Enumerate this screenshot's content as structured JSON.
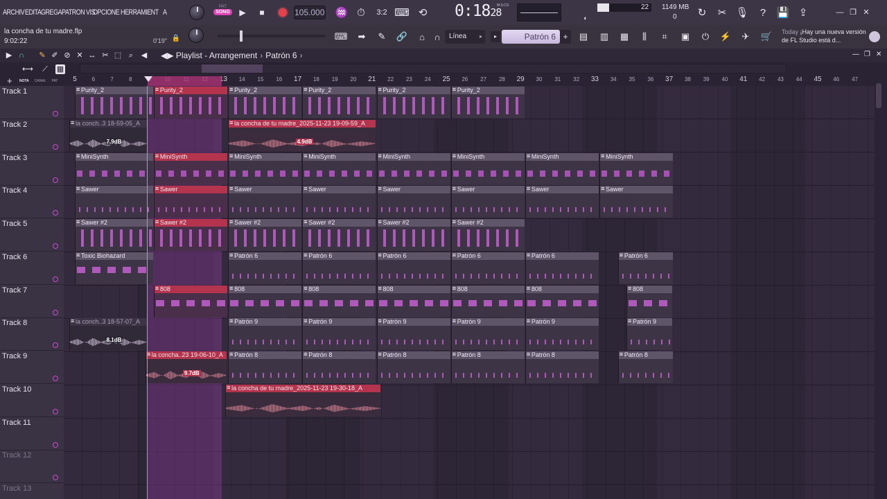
{
  "menu": [
    "ARCHIV",
    "EDITA",
    "GREGA",
    "PATRON",
    "VIS",
    "OPCIONE",
    "HERRAMIENT",
    "A"
  ],
  "pat_song": {
    "pat": "PAT",
    "song": "SONG",
    "mode": "song"
  },
  "tempo": "105.000",
  "time": {
    "main": "0:18",
    "sub": "28",
    "unit": "M:S:CS"
  },
  "cpu": {
    "value": "22",
    "level": 0.22
  },
  "memory": {
    "value": "1149 MB",
    "polyphony": "0"
  },
  "project": {
    "file": "la concha de tu madre.flp",
    "time": "9:02:22",
    "hint_value": "0'19\""
  },
  "snap": {
    "value": "Línea"
  },
  "pattern_selector": {
    "value": "Patrón 6"
  },
  "news": {
    "label": "Today",
    "text": "¡Hay una nueva versión de FL Studio está d..."
  },
  "playlist": {
    "title": "Playlist - Arrangement",
    "pattern": "Patrón 6",
    "tabs": [
      "NOTA",
      "CANAL",
      "PAT"
    ],
    "ruler": [
      "5",
      "6",
      "7",
      "8",
      "9",
      "10",
      "11",
      "12",
      "13",
      "14",
      "15",
      "16",
      "17",
      "18",
      "19",
      "20",
      "21",
      "22",
      "23",
      "24",
      "25",
      "26",
      "27",
      "28",
      "29",
      "30",
      "31",
      "32",
      "33",
      "34",
      "35",
      "36",
      "37",
      "38",
      "39",
      "40",
      "41",
      "42",
      "43",
      "44",
      "45",
      "46",
      "47"
    ],
    "tracks": [
      "Track 1",
      "Track 2",
      "Track 3",
      "Track 4",
      "Track 5",
      "Track 6",
      "Track 7",
      "Track 8",
      "Track 9",
      "Track 10",
      "Track 11",
      "Track 12",
      "Track 13"
    ]
  },
  "clips": [
    {
      "track": 1,
      "name": "Purity_2",
      "start": 5,
      "len": 4.25,
      "kind": "pat",
      "sel": false,
      "notes": "a"
    },
    {
      "track": 1,
      "name": "Purity_2",
      "start": 9.25,
      "len": 4,
      "kind": "pat",
      "sel": true,
      "notes": "a"
    },
    {
      "track": 1,
      "name": "Purity_2",
      "start": 13.25,
      "len": 4,
      "kind": "pat",
      "sel": false,
      "notes": "a"
    },
    {
      "track": 1,
      "name": "Purity_2",
      "start": 17.25,
      "len": 4,
      "kind": "pat",
      "sel": false,
      "notes": "a"
    },
    {
      "track": 1,
      "name": "Purity_2",
      "start": 21.25,
      "len": 4,
      "kind": "pat",
      "sel": false,
      "notes": "a"
    },
    {
      "track": 1,
      "name": "Purity_2",
      "start": 25.25,
      "len": 4,
      "kind": "pat",
      "sel": false,
      "notes": "a"
    },
    {
      "track": 2,
      "name": "la conch..3 18-59-05_A",
      "start": 4.7,
      "len": 4.2,
      "kind": "audio",
      "sel": false,
      "db": "7.9dB"
    },
    {
      "track": 2,
      "name": "la concha de tu madre_2025-11-23 19-09-59_A",
      "start": 13.25,
      "len": 8,
      "kind": "audio",
      "sel": true,
      "db": "4.9dB"
    },
    {
      "track": 3,
      "name": "MiniSynth",
      "start": 5,
      "len": 4.25,
      "kind": "pat",
      "sel": false,
      "notes": "b"
    },
    {
      "track": 3,
      "name": "MiniSynth",
      "start": 9.25,
      "len": 4,
      "kind": "pat",
      "sel": true,
      "notes": "b"
    },
    {
      "track": 3,
      "name": "MiniSynth",
      "start": 13.25,
      "len": 4,
      "kind": "pat",
      "sel": false,
      "notes": "b"
    },
    {
      "track": 3,
      "name": "MiniSynth",
      "start": 17.25,
      "len": 4,
      "kind": "pat",
      "sel": false,
      "notes": "b"
    },
    {
      "track": 3,
      "name": "MiniSynth",
      "start": 21.25,
      "len": 4,
      "kind": "pat",
      "sel": false,
      "notes": "b"
    },
    {
      "track": 3,
      "name": "MiniSynth",
      "start": 25.25,
      "len": 4,
      "kind": "pat",
      "sel": false,
      "notes": "b"
    },
    {
      "track": 3,
      "name": "MiniSynth",
      "start": 29.25,
      "len": 4,
      "kind": "pat",
      "sel": false,
      "notes": "b"
    },
    {
      "track": 3,
      "name": "MiniSynth",
      "start": 33.25,
      "len": 4,
      "kind": "pat",
      "sel": false,
      "notes": "b"
    },
    {
      "track": 4,
      "name": "Sawer",
      "start": 5,
      "len": 4.25,
      "kind": "pat",
      "sel": false,
      "notes": "c"
    },
    {
      "track": 4,
      "name": "Sawer",
      "start": 9.25,
      "len": 4,
      "kind": "pat",
      "sel": true,
      "notes": "c"
    },
    {
      "track": 4,
      "name": "Sawer",
      "start": 13.25,
      "len": 4,
      "kind": "pat",
      "sel": false,
      "notes": "c"
    },
    {
      "track": 4,
      "name": "Sawer",
      "start": 17.25,
      "len": 4,
      "kind": "pat",
      "sel": false,
      "notes": "c"
    },
    {
      "track": 4,
      "name": "Sawer",
      "start": 21.25,
      "len": 4,
      "kind": "pat",
      "sel": false,
      "notes": "c"
    },
    {
      "track": 4,
      "name": "Sawer",
      "start": 25.25,
      "len": 4,
      "kind": "pat",
      "sel": false,
      "notes": "c"
    },
    {
      "track": 4,
      "name": "Sawer",
      "start": 29.25,
      "len": 4,
      "kind": "pat",
      "sel": false,
      "notes": "c"
    },
    {
      "track": 4,
      "name": "Sawer",
      "start": 33.25,
      "len": 4,
      "kind": "pat",
      "sel": false,
      "notes": "c"
    },
    {
      "track": 5,
      "name": "Sawer #2",
      "start": 5,
      "len": 4.25,
      "kind": "pat",
      "sel": false,
      "notes": "a"
    },
    {
      "track": 5,
      "name": "Sawer #2",
      "start": 9.25,
      "len": 4,
      "kind": "pat",
      "sel": true,
      "notes": "a"
    },
    {
      "track": 5,
      "name": "Sawer #2",
      "start": 13.25,
      "len": 4,
      "kind": "pat",
      "sel": false,
      "notes": "a"
    },
    {
      "track": 5,
      "name": "Sawer #2",
      "start": 17.25,
      "len": 4,
      "kind": "pat",
      "sel": false,
      "notes": "a"
    },
    {
      "track": 5,
      "name": "Sawer #2",
      "start": 21.25,
      "len": 4,
      "kind": "pat",
      "sel": false,
      "notes": "a"
    },
    {
      "track": 5,
      "name": "Sawer #2",
      "start": 25.25,
      "len": 4,
      "kind": "pat",
      "sel": false,
      "notes": "a"
    },
    {
      "track": 6,
      "name": "Toxic Biohazard",
      "start": 5,
      "len": 4.25,
      "kind": "pat",
      "sel": false,
      "notes": "d"
    },
    {
      "track": 6,
      "name": "Patrón 6",
      "start": 13.25,
      "len": 4,
      "kind": "pat",
      "sel": false,
      "notes": "c"
    },
    {
      "track": 6,
      "name": "Patrón 6",
      "start": 17.25,
      "len": 4,
      "kind": "pat",
      "sel": false,
      "notes": "c"
    },
    {
      "track": 6,
      "name": "Patrón 6",
      "start": 21.25,
      "len": 4,
      "kind": "pat",
      "sel": false,
      "notes": "c"
    },
    {
      "track": 6,
      "name": "Patrón 6",
      "start": 25.25,
      "len": 4,
      "kind": "pat",
      "sel": false,
      "notes": "c"
    },
    {
      "track": 6,
      "name": "Patrón 6",
      "start": 29.25,
      "len": 4,
      "kind": "pat",
      "sel": false,
      "notes": "c"
    },
    {
      "track": 6,
      "name": "Patrón 6",
      "start": 34.25,
      "len": 3,
      "kind": "pat",
      "sel": false,
      "notes": "c"
    },
    {
      "track": 7,
      "name": "808",
      "start": 9.25,
      "len": 4,
      "kind": "pat",
      "sel": true,
      "notes": "d"
    },
    {
      "track": 7,
      "name": "808",
      "start": 13.25,
      "len": 4,
      "kind": "pat",
      "sel": false,
      "notes": "d"
    },
    {
      "track": 7,
      "name": "808",
      "start": 17.25,
      "len": 4,
      "kind": "pat",
      "sel": false,
      "notes": "d"
    },
    {
      "track": 7,
      "name": "808",
      "start": 21.25,
      "len": 4,
      "kind": "pat",
      "sel": false,
      "notes": "d"
    },
    {
      "track": 7,
      "name": "808",
      "start": 25.25,
      "len": 4,
      "kind": "pat",
      "sel": false,
      "notes": "d"
    },
    {
      "track": 7,
      "name": "808",
      "start": 29.25,
      "len": 4,
      "kind": "pat",
      "sel": false,
      "notes": "d"
    },
    {
      "track": 7,
      "name": "808",
      "start": 34.7,
      "len": 2.5,
      "kind": "pat",
      "sel": false,
      "notes": "d"
    },
    {
      "track": 8,
      "name": "la conch..3 18-57-07_A",
      "start": 4.7,
      "len": 4.2,
      "kind": "audio",
      "sel": false,
      "db": "8.1dB"
    },
    {
      "track": 8,
      "name": "Patrón 9",
      "start": 13.25,
      "len": 4,
      "kind": "pat",
      "sel": false,
      "notes": "c"
    },
    {
      "track": 8,
      "name": "Patrón 9",
      "start": 17.25,
      "len": 4,
      "kind": "pat",
      "sel": false,
      "notes": "c"
    },
    {
      "track": 8,
      "name": "Patrón 9",
      "start": 21.25,
      "len": 4,
      "kind": "pat",
      "sel": false,
      "notes": "c"
    },
    {
      "track": 8,
      "name": "Patrón 9",
      "start": 25.25,
      "len": 4,
      "kind": "pat",
      "sel": false,
      "notes": "c"
    },
    {
      "track": 8,
      "name": "Patrón 9",
      "start": 29.25,
      "len": 4,
      "kind": "pat",
      "sel": false,
      "notes": "c"
    },
    {
      "track": 8,
      "name": "Patrón 9",
      "start": 34.7,
      "len": 2.5,
      "kind": "pat",
      "sel": false,
      "notes": "c"
    },
    {
      "track": 9,
      "name": "la concha..23 19-06-10_A",
      "start": 8.8,
      "len": 4.4,
      "kind": "audio",
      "sel": true,
      "db": "9.7dB"
    },
    {
      "track": 9,
      "name": "Patrón 8",
      "start": 13.25,
      "len": 4,
      "kind": "pat",
      "sel": false,
      "notes": "c"
    },
    {
      "track": 9,
      "name": "Patrón 8",
      "start": 17.25,
      "len": 4,
      "kind": "pat",
      "sel": false,
      "notes": "c"
    },
    {
      "track": 9,
      "name": "Patrón 8",
      "start": 21.25,
      "len": 4,
      "kind": "pat",
      "sel": false,
      "notes": "c"
    },
    {
      "track": 9,
      "name": "Patrón 8",
      "start": 25.25,
      "len": 4,
      "kind": "pat",
      "sel": false,
      "notes": "c"
    },
    {
      "track": 9,
      "name": "Patrón 8",
      "start": 29.25,
      "len": 4,
      "kind": "pat",
      "sel": false,
      "notes": "c"
    },
    {
      "track": 9,
      "name": "Patrón 8",
      "start": 34.25,
      "len": 3,
      "kind": "pat",
      "sel": false,
      "notes": "c"
    },
    {
      "track": 10,
      "name": "la concha de tu madre_2025-11-23 19-30-18_A",
      "start": 13.1,
      "len": 8.4,
      "kind": "audio",
      "sel": true
    }
  ],
  "colors": {
    "selected_clip": "#b4334d",
    "pattern_clip": "#5e5568",
    "accent": "#e040b8",
    "notes": "#c35fd0"
  }
}
